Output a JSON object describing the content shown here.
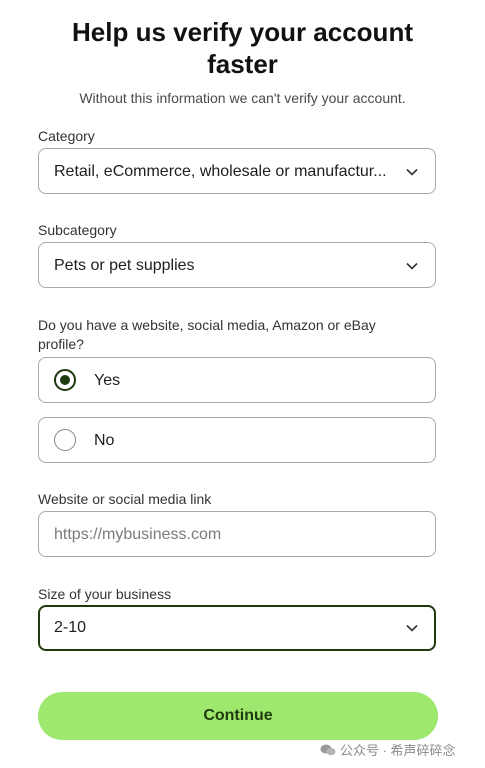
{
  "header": {
    "title_line1": "Help us verify your account",
    "title_line2": "faster",
    "subtitle": "Without this information we can't verify your account."
  },
  "category": {
    "label": "Category",
    "value": "Retail, eCommerce, wholesale or manufactur..."
  },
  "subcategory": {
    "label": "Subcategory",
    "value": "Pets or pet supplies"
  },
  "online_presence": {
    "label": "Do you have a website, social media, Amazon or eBay profile?",
    "options": [
      {
        "label": "Yes",
        "selected": true
      },
      {
        "label": "No",
        "selected": false
      }
    ]
  },
  "website": {
    "label": "Website or social media link",
    "value": "",
    "placeholder": "https://mybusiness.com"
  },
  "business_size": {
    "label": "Size of your business",
    "value": "2-10"
  },
  "continue_label": "Continue",
  "watermark": {
    "icon": "wechat-icon",
    "text": "公众号 · 希声碎碎念"
  },
  "colors": {
    "accent_dark": "#1f3a0e",
    "button_green": "#9ee86e",
    "border": "#a9a9a9"
  }
}
